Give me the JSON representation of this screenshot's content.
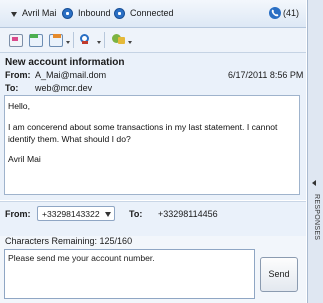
{
  "header": {
    "agent_name": "Avril Mai",
    "direction": "Inbound",
    "status": "Connected",
    "count": "(41)"
  },
  "toolbar": {
    "icons": [
      "compose-icon",
      "reply-icon",
      "forward-icon",
      "search-icon",
      "tools-icon"
    ]
  },
  "message": {
    "subject": "New account information",
    "from_label": "From:",
    "from_value": "A_Mai@mail.dom",
    "date": "6/17/2011 8:56 PM",
    "to_label": "To:",
    "to_value": "web@mcr.dev",
    "body_lines": [
      "Hello,",
      "I am concerend about some transactions in my last statement. I cannot",
      "identify them. What should I do?",
      "Avril Mai"
    ]
  },
  "reply": {
    "from_label": "From:",
    "from_value": "+33298143322",
    "to_label": "To:",
    "to_value": "+33298114456",
    "chars_remaining": "Characters Remaining: 125/160",
    "text": "Please send me your account number.",
    "send_label": "Send"
  },
  "side_panel": {
    "label": "RESPONSES"
  },
  "colors": {
    "accent": "#2a6fc4",
    "panel_bg": "#eaf1fa",
    "border": "#9fb3cc"
  }
}
